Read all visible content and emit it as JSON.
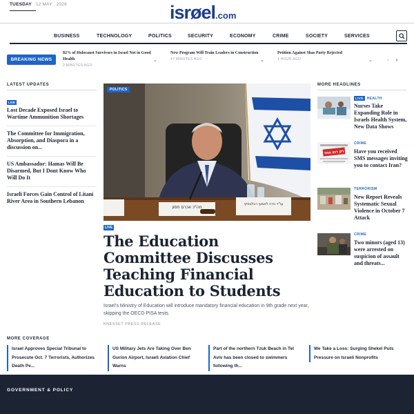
{
  "header": {
    "day": "TUESDAY",
    "date_rest": " . 12 MAY . 2026",
    "logo_main": "isrøel",
    "logo_tld": ".com"
  },
  "nav": {
    "items": [
      "BUSINESS",
      "TECHNOLOGY",
      "POLITICS",
      "SECURITY",
      "ECONOMY",
      "CRIME",
      "SOCIETY",
      "SERVICES"
    ],
    "search_icon": "search-icon"
  },
  "ticker": {
    "label": "BREAKING NEWS",
    "items": [
      {
        "title": "82% of Holocaust Survivors in Israel Not in Good Health",
        "time": "2 MINUTES AGO"
      },
      {
        "title": "New Program Will Train Leaders in Construction",
        "time": "47 MINUTES AGO"
      },
      {
        "title": "Petition Against Shas Party Rejected",
        "time": "1 HOUR AGO"
      }
    ],
    "prev": "‹",
    "next": "›"
  },
  "latest": {
    "label": "LATEST UPDATES",
    "items": [
      {
        "badge": "LIVE",
        "title": "Lost Decade Exposed Israel to Wartime Ammunition Shortages"
      },
      {
        "badge": "",
        "title": "The Committee for Immigration, Absorption, and Diaspora in a discussion on..."
      },
      {
        "badge": "",
        "title": "US Ambassador: Hamas Will Be Disarmed, But I Dont Know Who Will Do It"
      },
      {
        "badge": "",
        "title": "Israeli Forces Gain Control of Litani River Area in Southern Lebanon"
      }
    ]
  },
  "main_story": {
    "category": "POLITICS",
    "badge": "LIVE",
    "headline": "The Education Committee Discusses Teaching Financial Education to Students",
    "summary": "Israel's Ministry of Education will introduce mandatory financial education in 9th grade next year, skipping the OECD PISA tests.",
    "source": "KNESSET PRESS RELEASE",
    "nameplate_left": "חה\"כ אכרם חסון",
    "nameplate_right": "עו\"ד נירה לאמעי רבלבסקי"
  },
  "more_headlines": {
    "label": "MORE HEADLINES",
    "items": [
      {
        "badge": "LIVE",
        "category": "HEALTH",
        "title": "Nurses Take Expanding Role in Israels Health System, New Data Shows"
      },
      {
        "badge": "",
        "category": "CRIME",
        "title": "Have you received SMS messages inviting you to contact Iran?"
      },
      {
        "badge": "",
        "category": "TERRORISM",
        "title": "New Report Reveals Systematic Sexual Violence in October 7 Attack"
      },
      {
        "badge": "",
        "category": "CRIME",
        "title": "Two minors (aged 13) were arrested on suspicion of assault and threats..."
      }
    ],
    "sms_thumb_text": "רק רגע אחד"
  },
  "coverage": {
    "label": "MORE COVERAGE",
    "items": [
      "Israel Approves Special Tribunal to Prosecute Oct. 7 Terrorists, Authorizes Death Pe...",
      "US Military Jets Are Taking Over Ben Gurion Airport, Israeli Aviation Chief Warns",
      "Part of the northern Tzuk Beach in Tel Aviv has been closed to swimmers following th...",
      "We Take a Loss: Surging Shekel Puts Pressure on Israeli Nonprofits"
    ]
  },
  "footer": {
    "title": "GOVERNMENT & POLICY"
  },
  "colors": {
    "accent": "#1e64c8",
    "logo": "#1e3e8c",
    "text": "#1c2333",
    "footer_bg": "#1c2333"
  }
}
